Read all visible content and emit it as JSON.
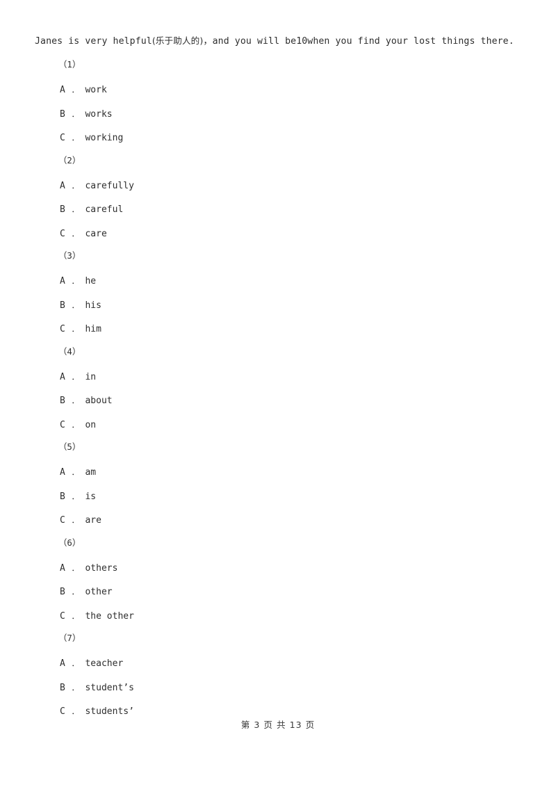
{
  "document": {
    "stem": {
      "text_before_gloss": "Janes is very helpful",
      "gloss": "(乐于助人的)",
      "text_after_gloss": "，and you will be10when you find your lost things there.",
      "full_text": "Janes is very helpful(乐于助人的)，and you will be10when you find your lost things there."
    },
    "questions": [
      {
        "number": "（1）",
        "options": [
          {
            "label": "A",
            "sep": "．",
            "text": "work"
          },
          {
            "label": "B",
            "sep": "．",
            "text": "works"
          },
          {
            "label": "C",
            "sep": "．",
            "text": "working"
          }
        ]
      },
      {
        "number": "（2）",
        "options": [
          {
            "label": "A",
            "sep": "．",
            "text": "carefully"
          },
          {
            "label": "B",
            "sep": "．",
            "text": "careful"
          },
          {
            "label": "C",
            "sep": "．",
            "text": "care"
          }
        ]
      },
      {
        "number": "（3）",
        "options": [
          {
            "label": "A",
            "sep": "．",
            "text": "he"
          },
          {
            "label": "B",
            "sep": "．",
            "text": "his"
          },
          {
            "label": "C",
            "sep": "．",
            "text": "him"
          }
        ]
      },
      {
        "number": "（4）",
        "options": [
          {
            "label": "A",
            "sep": "．",
            "text": "in"
          },
          {
            "label": "B",
            "sep": "．",
            "text": "about"
          },
          {
            "label": "C",
            "sep": "．",
            "text": "on"
          }
        ]
      },
      {
        "number": "（5）",
        "options": [
          {
            "label": "A",
            "sep": "．",
            "text": "am"
          },
          {
            "label": "B",
            "sep": "．",
            "text": "is"
          },
          {
            "label": "C",
            "sep": "．",
            "text": "are"
          }
        ]
      },
      {
        "number": "（6）",
        "options": [
          {
            "label": "A",
            "sep": "．",
            "text": "others"
          },
          {
            "label": "B",
            "sep": "．",
            "text": "other"
          },
          {
            "label": "C",
            "sep": "．",
            "text": "the other"
          }
        ]
      },
      {
        "number": "（7）",
        "options": [
          {
            "label": "A",
            "sep": "．",
            "text": "teacher"
          },
          {
            "label": "B",
            "sep": "．",
            "text": "student’s"
          },
          {
            "label": "C",
            "sep": "．",
            "text": "students’"
          }
        ]
      }
    ],
    "footer": {
      "text": "第 3 页 共 13 页",
      "current_page": "3",
      "total_pages": "13"
    },
    "colors": {
      "page_background": "#ffffff",
      "text": "#2e2e2e"
    }
  }
}
